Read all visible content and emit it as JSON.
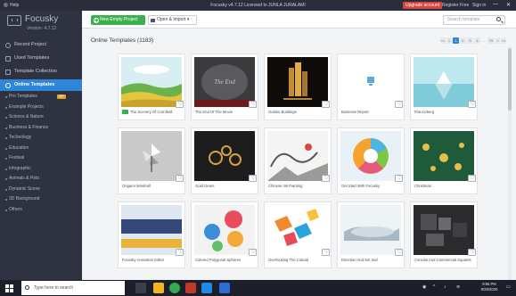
{
  "titlebar": {
    "help": "Help",
    "title": "Focusky v4.7.12   Licensed to JUNLA JURALAMI",
    "upgrade": "Upgrade account",
    "register": "Register Free",
    "signin": "Sign in",
    "accent": "#d6453d"
  },
  "sidebar": {
    "brand": "Focusky",
    "version": "Version: 4.7.12",
    "menu": [
      {
        "label": "Recent Project",
        "icon": "clock-icon"
      },
      {
        "label": "Used Templates",
        "icon": "grid-icon"
      },
      {
        "label": "Template Collection",
        "icon": "collection-icon"
      },
      {
        "label": "Online Templates",
        "icon": "globe-icon",
        "active": true
      }
    ],
    "categories": [
      {
        "label": "Pro Templates",
        "badge": "VIP"
      },
      {
        "label": "Example Projects"
      },
      {
        "label": "Science & Nature"
      },
      {
        "label": "Business & Finance"
      },
      {
        "label": "Technology"
      },
      {
        "label": "Education"
      },
      {
        "label": "Festival"
      },
      {
        "label": "Infographic"
      },
      {
        "label": "Animals & Pets"
      },
      {
        "label": "Dynamic Scene"
      },
      {
        "label": "3D Background"
      },
      {
        "label": "Others"
      }
    ]
  },
  "toolbar": {
    "new_project": "New Empty Project",
    "open_import": "Open & Import ▾",
    "search_placeholder": "Search template"
  },
  "content": {
    "title": "Online Templates (1183)",
    "pager": [
      "<<",
      "<",
      "1",
      "2",
      "3",
      "4",
      "...",
      "79",
      ">",
      ">>"
    ],
    "current_page": "1",
    "templates": [
      {
        "label": "The Scenery Of Cornfield",
        "thumb": "cornfield"
      },
      {
        "label": "The End Of The Movie",
        "thumb": "movie"
      },
      {
        "label": "Golden Buildings",
        "thumb": "golden"
      },
      {
        "label": "Business Report",
        "thumb": "report"
      },
      {
        "label": "Flat Iceberg",
        "thumb": "iceberg"
      },
      {
        "label": "Origami Windmill",
        "thumb": "windmill"
      },
      {
        "label": "Gold Gears",
        "thumb": "gears"
      },
      {
        "label": "Chinese Ink Painting",
        "thumb": "ink"
      },
      {
        "label": "Get Start With Focusky",
        "thumb": "wheel"
      },
      {
        "label": "Christmas",
        "thumb": "christmas"
      },
      {
        "label": "Focusky Animation Editor",
        "thumb": "editor"
      },
      {
        "label": "Colored Polygonal Spheres",
        "thumb": "spheres"
      },
      {
        "label": "Overlooking The Cuboid",
        "thumb": "cuboid"
      },
      {
        "label": "Direction And Set Sail",
        "thumb": "sail"
      },
      {
        "label": "Concise And Commercial Squares",
        "thumb": "squares"
      }
    ]
  },
  "taskbar": {
    "search_placeholder": "Type here to search",
    "time": "9:55 PM",
    "date": "9/28/2020"
  }
}
